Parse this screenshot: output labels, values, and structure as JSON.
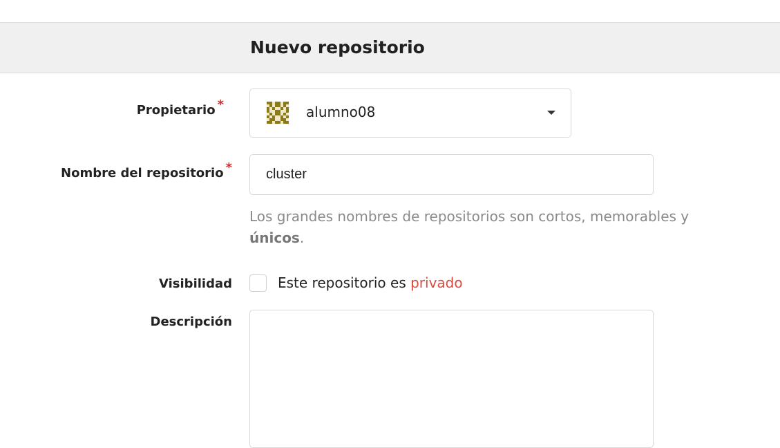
{
  "page": {
    "title": "Nuevo repositorio"
  },
  "form": {
    "owner": {
      "label": "Propietario",
      "required_mark": "*",
      "selected_value": "alumno08",
      "avatar_icon": "identicon-avatar"
    },
    "repo_name": {
      "label": "Nombre del repositorio",
      "required_mark": "*",
      "value": "cluster",
      "help_text_prefix": "Los grandes nombres de repositorios son cortos, memorables y",
      "help_text_bold": "únicos",
      "help_text_suffix": "."
    },
    "visibility": {
      "label": "Visibilidad",
      "checkbox_checked": false,
      "checkbox_text": "Este repositorio es",
      "checkbox_text_highlight": "privado"
    },
    "description": {
      "label": "Descripción",
      "value": ""
    }
  },
  "colors": {
    "header_bg": "#f0f0f0",
    "required": "#db2828",
    "private_highlight": "#db4a3e",
    "help_text": "#8a8a8a",
    "avatar": "#8a7a1a"
  }
}
